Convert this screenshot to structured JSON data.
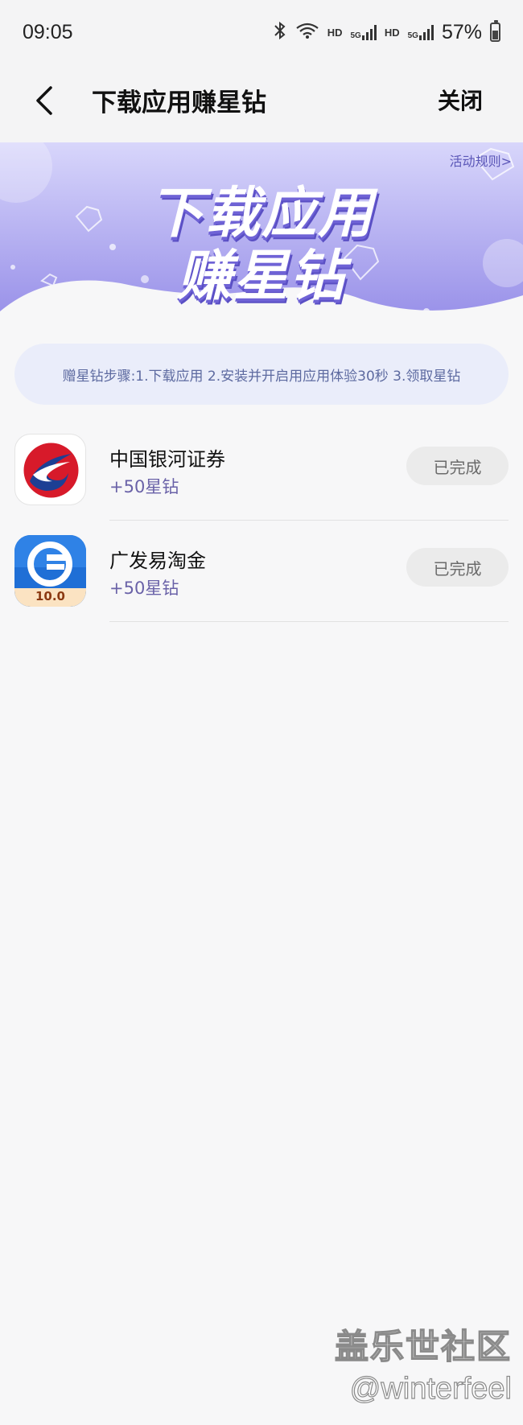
{
  "status_bar": {
    "time": "09:05",
    "hd_1": "HD",
    "net_1": "5G",
    "hd_2": "HD",
    "net_2": "5G",
    "battery": "57%"
  },
  "nav": {
    "title": "下载应用赚星钻",
    "close_label": "关闭"
  },
  "banner": {
    "rules_link": "活动规则>",
    "title_line1": "下载应用",
    "title_line2": "赚星钻",
    "colors": {
      "top": "#d8d6fb",
      "bottom": "#8f86e6",
      "accent": "#6f63d6"
    }
  },
  "steps": {
    "text": "赠星钻步骤:1.下载应用 2.安装并开启用应用体验30秒 3.领取星钻"
  },
  "apps": [
    {
      "name": "中国银河证券",
      "reward": "+50星钻",
      "status": "已完成",
      "icon": "galaxy-securities-logo"
    },
    {
      "name": "广发易淘金",
      "reward": "+50星钻",
      "status": "已完成",
      "icon": "gf-yitaojin-logo",
      "icon_badge": "10.0"
    }
  ],
  "watermark": {
    "site": "盖乐世社区",
    "user": "@winterfeel"
  }
}
